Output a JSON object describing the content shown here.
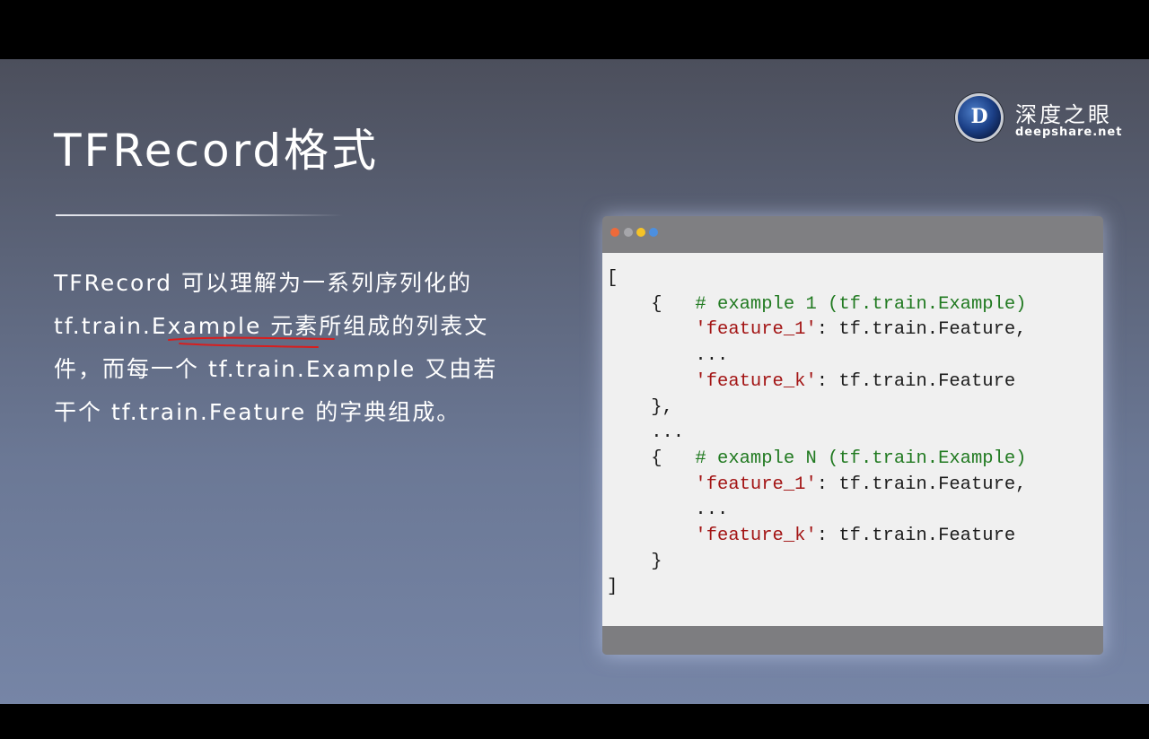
{
  "slide": {
    "title": "TFRecord格式",
    "logo": {
      "letter": "D",
      "name_cn": "深度之眼",
      "name_en": "deepshare.net"
    },
    "description_lines": [
      "TFRecord 可以理解为一系列序列化的",
      "tf.train.Example 元素所组成的列表文",
      "件，而每一个 tf.train.Example 又由若",
      "干个 tf.train.Feature 的字典组成。"
    ],
    "annotation_color": "#d81e1e",
    "code_window": {
      "dot_colors": [
        "#ee6a3a",
        "#a6a6aa",
        "#f5c328",
        "#4c8fdf"
      ],
      "lines": [
        [
          {
            "t": "[",
            "c": "plain"
          }
        ],
        [
          {
            "t": "    {   ",
            "c": "plain"
          },
          {
            "t": "# example 1 (tf.train.Example)",
            "c": "comment"
          }
        ],
        [
          {
            "t": "        ",
            "c": "plain"
          },
          {
            "t": "'feature_1'",
            "c": "string"
          },
          {
            "t": ": tf.train.Feature,",
            "c": "plain"
          }
        ],
        [
          {
            "t": "        ...",
            "c": "plain"
          }
        ],
        [
          {
            "t": "        ",
            "c": "plain"
          },
          {
            "t": "'feature_k'",
            "c": "string"
          },
          {
            "t": ": tf.train.Feature",
            "c": "plain"
          }
        ],
        [
          {
            "t": "    },",
            "c": "plain"
          }
        ],
        [
          {
            "t": "    ...",
            "c": "plain"
          }
        ],
        [
          {
            "t": "    {   ",
            "c": "plain"
          },
          {
            "t": "# example N (tf.train.Example)",
            "c": "comment"
          }
        ],
        [
          {
            "t": "        ",
            "c": "plain"
          },
          {
            "t": "'feature_1'",
            "c": "string"
          },
          {
            "t": ": tf.train.Feature,",
            "c": "plain"
          }
        ],
        [
          {
            "t": "        ...",
            "c": "plain"
          }
        ],
        [
          {
            "t": "        ",
            "c": "plain"
          },
          {
            "t": "'feature_k'",
            "c": "string"
          },
          {
            "t": ": tf.train.Feature",
            "c": "plain"
          }
        ],
        [
          {
            "t": "    }",
            "c": "plain"
          }
        ],
        [
          {
            "t": "]",
            "c": "plain"
          }
        ]
      ]
    }
  }
}
